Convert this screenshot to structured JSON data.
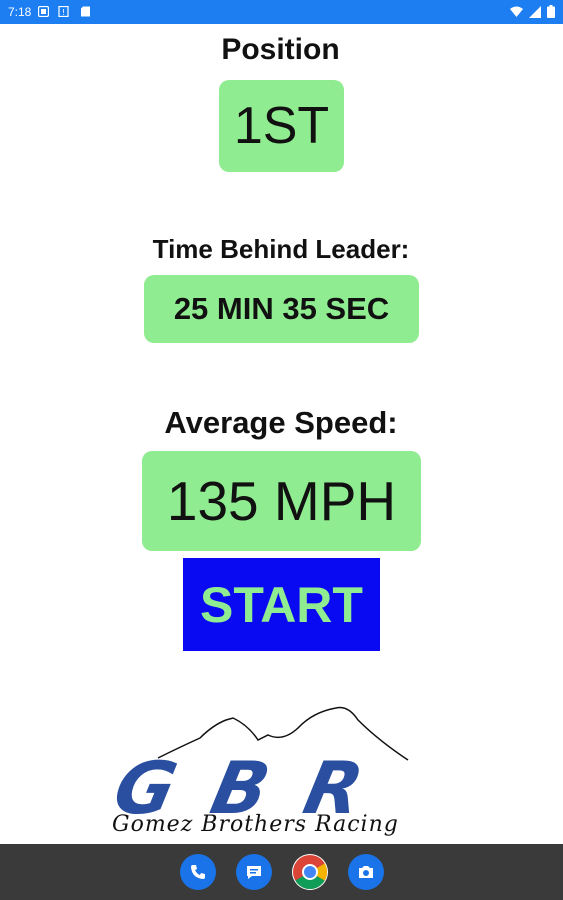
{
  "status_bar": {
    "time": "7:18"
  },
  "position": {
    "label": "Position",
    "value": "1ST"
  },
  "time_behind": {
    "label": "Time Behind Leader:",
    "value": "25 MIN 35 SEC"
  },
  "average_speed": {
    "label": "Average Speed:",
    "value": "135 MPH"
  },
  "start_button": {
    "label": "START"
  },
  "logo": {
    "letters": "GBR",
    "tagline": "Gomez Brothers Racing"
  },
  "dock": {
    "icons": [
      "phone-icon",
      "messages-icon",
      "chrome-icon",
      "camera-icon"
    ]
  },
  "colors": {
    "status_bar": "#1c7ef0",
    "value_background": "#90ec90",
    "start_background": "#0a0af2",
    "start_text": "#90ec90",
    "logo_blue": "#2a4fa0",
    "nav_bar": "#3a3a3a"
  }
}
